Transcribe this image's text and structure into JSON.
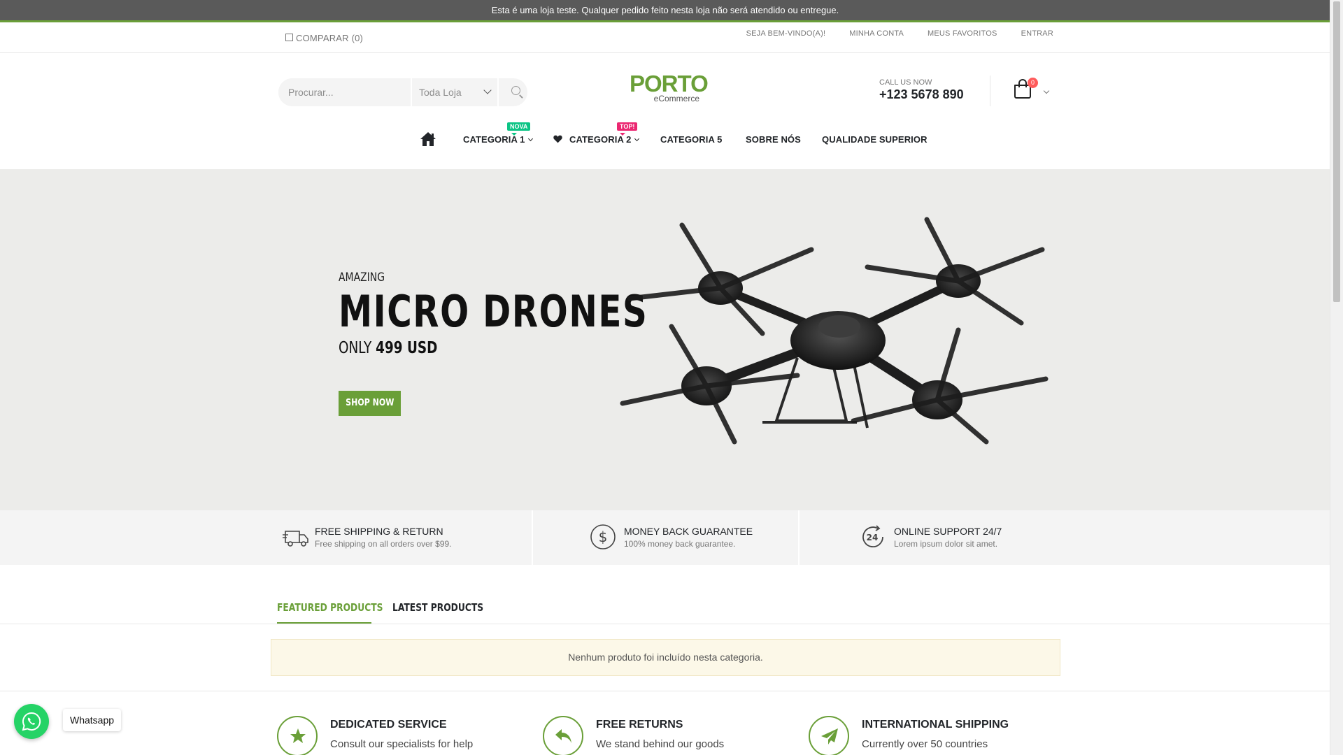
{
  "demo_notice": "Esta é uma loja teste. Qualquer pedido feito nesta loja não será atendido ou entregue.",
  "topbar": {
    "compare_label": "COMPARAR (0)",
    "links": [
      "SEJA BEM-VINDO(A)!",
      "MINHA CONTA",
      "MEUS FAVORITOS",
      "ENTRAR"
    ]
  },
  "search": {
    "placeholder": "Procurar...",
    "category": "Toda Loja"
  },
  "logo": {
    "main": "PORTO",
    "sub": "eCommerce"
  },
  "contact": {
    "label": "CALL US NOW",
    "phone": "+123 5678 890"
  },
  "cart": {
    "count": "0"
  },
  "nav": {
    "items": [
      {
        "label": "CATEGORIA 1",
        "badge": "NOVA"
      },
      {
        "label": "CATEGORIA 2",
        "badge": "TOP!"
      },
      {
        "label": "CATEGORIA 5"
      },
      {
        "label": "SOBRE NÓS"
      },
      {
        "label": "QUALIDADE SUPERIOR"
      }
    ]
  },
  "hero": {
    "kicker": "AMAZING",
    "title": "MICRO DRONES",
    "price_prefix": "ONLY",
    "price": "499 USD",
    "cta": "SHOP NOW"
  },
  "info_boxes": [
    {
      "title": "FREE SHIPPING & RETURN",
      "sub": "Free shipping on all orders over $99.",
      "icon": "truck-icon"
    },
    {
      "title": "MONEY BACK GUARANTEE",
      "sub": "100% money back guarantee.",
      "icon": "dollar-icon"
    },
    {
      "title": "ONLINE SUPPORT 24/7",
      "sub": "Lorem ipsum dolor sit amet.",
      "icon": "support-24-icon"
    }
  ],
  "tabs": [
    {
      "label": "FEATURED PRODUCTS",
      "active": true
    },
    {
      "label": "LATEST PRODUCTS",
      "active": false
    }
  ],
  "empty_notice": "Nenhum produto foi incluído nesta categoria.",
  "services": [
    {
      "title": "DEDICATED SERVICE",
      "sub": "Consult our specialists for help",
      "icon": "star-icon"
    },
    {
      "title": "FREE RETURNS",
      "sub": "We stand behind our goods",
      "icon": "reply-icon"
    },
    {
      "title": "INTERNATIONAL SHIPPING",
      "sub": "Currently over 50 countries",
      "icon": "paper-plane-icon"
    }
  ],
  "whatsapp": {
    "label": "Whatsapp"
  },
  "colors": {
    "accent": "#6a9f38",
    "badge_new": "#0cc485",
    "badge_hot": "#eb2771",
    "cart_badge": "#ff5b5b"
  }
}
